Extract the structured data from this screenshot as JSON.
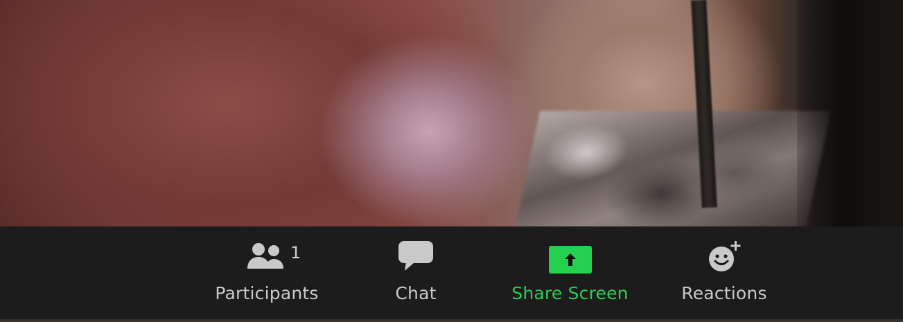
{
  "video": {
    "description_icon": "camera-feed"
  },
  "toolbar": {
    "participants": {
      "label": "Participants",
      "count": "1",
      "icon": "participants-icon"
    },
    "chat": {
      "label": "Chat",
      "icon": "chat-bubble-icon"
    },
    "share_screen": {
      "label": "Share Screen",
      "icon": "share-screen-arrow-icon",
      "color": "#23d04f"
    },
    "reactions": {
      "label": "Reactions",
      "icon": "smiley-plus-icon"
    }
  },
  "colors": {
    "toolbar_bg": "#1c1c1c",
    "label_text": "#c9c9c9",
    "accent_green": "#23d04f"
  }
}
